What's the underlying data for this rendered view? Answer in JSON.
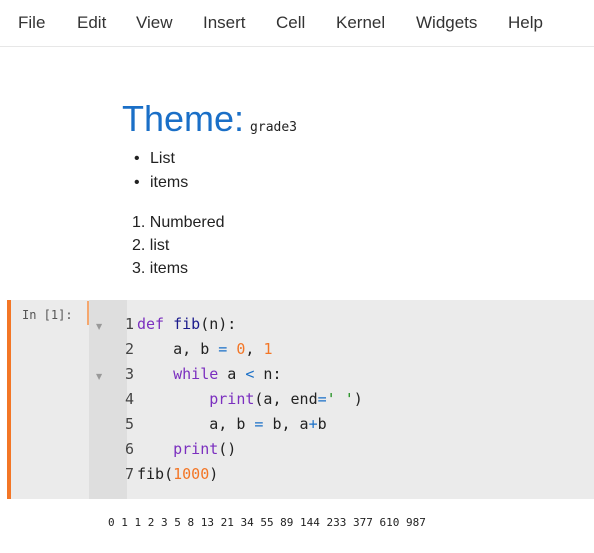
{
  "menu": [
    "File",
    "Edit",
    "View",
    "Insert",
    "Cell",
    "Kernel",
    "Widgets",
    "Help"
  ],
  "markdown": {
    "title": "Theme:",
    "theme_name": "grade3",
    "bullets": [
      "List",
      "items"
    ],
    "numbered": [
      "1. Numbered",
      "2. list",
      "3. items"
    ]
  },
  "code_cell": {
    "prompt": "In [1]:",
    "line_numbers": [
      "1",
      "2",
      "3",
      "4",
      "5",
      "6",
      "7"
    ],
    "tokens": {
      "l1_def": "def",
      "l1_fn": "fib",
      "l1_rest": "(n):",
      "l2_a": "a, b ",
      "l2_eq": "=",
      "l2_zero": "0",
      "l2_comma": ", ",
      "l2_one": "1",
      "l3_while": "while",
      "l3_a": " a ",
      "l3_lt": "<",
      "l3_n": " n:",
      "l4_print": "print",
      "l4_args": "(a, end",
      "l4_eq": "=",
      "l4_str": "' '",
      "l4_close": ")",
      "l5_a": "a, b ",
      "l5_eq": "=",
      "l5_b": " b, a",
      "l5_plus": "+",
      "l5_bend": "b",
      "l6_print": "print",
      "l6_paren": "()",
      "l7_fib": "fib(",
      "l7_num": "1000",
      "l7_close": ")"
    }
  },
  "output": "0 1 1 2 3 5 8 13 21 34 55 89 144 233 377 610 987",
  "colors": {
    "accent_orange": "#f37626",
    "title_blue": "#1a6fc7",
    "keyword_purple": "#7b2fbf",
    "string_green": "#1a8c1a"
  }
}
